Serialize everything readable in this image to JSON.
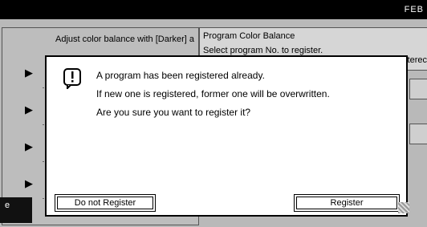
{
  "top_bar": {
    "date": "FEB"
  },
  "background": {
    "left_header": "Adjust color balance with [Darker] a",
    "right_title": "Program Color Balance",
    "right_subtitle": "Select program No. to register.",
    "right_fragment": "terec",
    "corner_label": "e"
  },
  "dialog": {
    "icon": "info-icon",
    "lines": [
      "A program has been registered already.",
      "If new one is registered, former one will be overwritten.",
      "Are you sure you want to register it?"
    ],
    "buttons": {
      "cancel_label": "Do not Register",
      "confirm_label": "Register"
    }
  }
}
